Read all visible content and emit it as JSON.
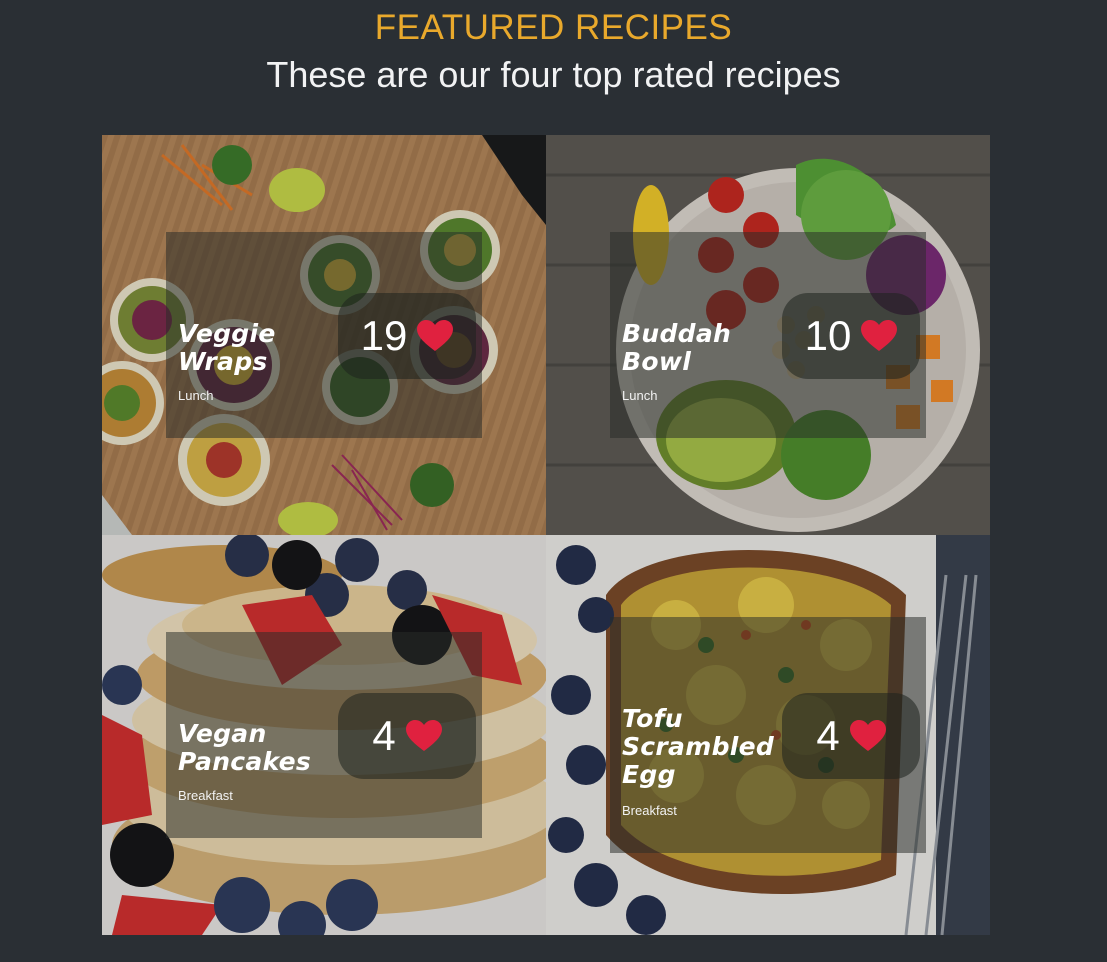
{
  "header": {
    "eyebrow": "FEATURED RECIPES",
    "subtitle": "These are our four top rated recipes"
  },
  "colors": {
    "background": "#2a2f34",
    "accent": "#e9a92c",
    "heart": "#e0213f"
  },
  "recipes": [
    {
      "name_line1": "Veggie",
      "name_line2": "Wraps",
      "name_line3": "",
      "category": "Lunch",
      "likes": "19",
      "icon": "heart-icon"
    },
    {
      "name_line1": "Buddah",
      "name_line2": "Bowl",
      "name_line3": "",
      "category": "Lunch",
      "likes": "10",
      "icon": "heart-icon"
    },
    {
      "name_line1": "Vegan",
      "name_line2": "Pancakes",
      "name_line3": "",
      "category": "Breakfast",
      "likes": "4",
      "icon": "heart-icon"
    },
    {
      "name_line1": "Tofu",
      "name_line2": "Scrambled",
      "name_line3": "Egg",
      "category": "Breakfast",
      "likes": "4",
      "icon": "heart-icon"
    }
  ]
}
